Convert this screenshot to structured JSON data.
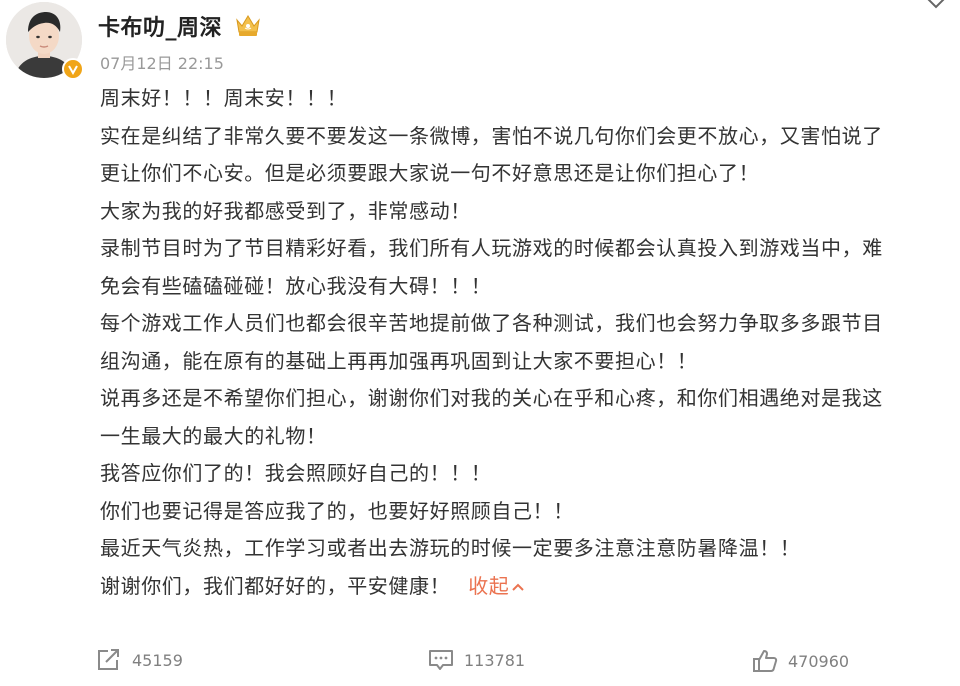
{
  "post": {
    "username": "卡布叻_周深",
    "timestamp": "07月12日 22:15",
    "lines": [
      "周末好！！！周末安！！！",
      "实在是纠结了非常久要不要发这一条微博，害怕不说几句你们会更不放心，又害怕说了",
      "更让你们不心安。但是必须要跟大家说一句不好意思还是让你们担心了！",
      "大家为我的好我都感受到了，非常感动！",
      "录制节目时为了节目精彩好看，我们所有人玩游戏的时候都会认真投入到游戏当中，难",
      "免会有些磕磕碰碰！放心我没有大碍！！！",
      "每个游戏工作人员们也都会很辛苦地提前做了各种测试，我们也会努力争取多多跟节目",
      "组沟通，能在原有的基础上再再加强再巩固到让大家不要担心！！",
      "说再多还是不希望你们担心，谢谢你们对我的关心在乎和心疼，和你们相遇绝对是我这",
      "一生最大的最大的礼物！",
      "我答应你们了的！我会照顾好自己的！！！",
      "你们也要记得是答应我了的，也要好好照顾自己！！",
      "最近天气炎热，工作学习或者出去游玩的时候一定要多注意注意防暑降温！！",
      "谢谢你们，我们都好好的，平安健康！"
    ],
    "collapse_label": "收起"
  },
  "actions": {
    "repost_count": "45159",
    "comment_count": "113781",
    "like_count": "470960"
  },
  "icons": {
    "menu": "chevron-down-icon",
    "verified": "verified-badge-icon",
    "member": "crown-icon",
    "repost": "repost-icon",
    "comment": "comment-icon",
    "like": "thumbs-up-icon"
  },
  "colors": {
    "link": "#eb7350",
    "meta": "#999999",
    "text": "#333333",
    "verified": "#f0a518"
  }
}
